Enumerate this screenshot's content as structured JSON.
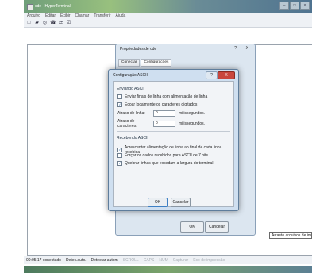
{
  "window": {
    "title": "cde - HyperTerminal",
    "controls": [
      "–",
      "□",
      "×"
    ]
  },
  "menu": [
    "Arquivo",
    "Editar",
    "Exibir",
    "Chamar",
    "Transferir",
    "Ajuda"
  ],
  "toolbar": {
    "icons": [
      "new-icon",
      "open-icon",
      "properties-icon",
      "disconnect-icon",
      "send-icon",
      "receive-icon"
    ],
    "glyphs": [
      "□",
      "▰",
      "◎",
      "☎",
      "⇄",
      "☑"
    ]
  },
  "properties_dialog": {
    "title": "Propriedades de cde",
    "help": "?",
    "close": "X",
    "tabs": [
      "Conectar",
      "Configurações"
    ],
    "ok": "OK",
    "cancel": "Cancelar"
  },
  "ascii_dialog": {
    "title": "Configuração ASCII",
    "help": "?",
    "close": "X",
    "sending_label": "Enviando ASCII",
    "send_line_ends": {
      "label": "Enviar finais de linha com alimentação de linha",
      "checked": false
    },
    "echo_local": {
      "label": "Ecoar localmente os caracteres digitados",
      "checked": true
    },
    "line_delay": {
      "label": "Atraso de linha:",
      "value": "0",
      "unit": "milissegundos."
    },
    "char_delay": {
      "label": "Atraso de caracteres:",
      "value": "0",
      "unit": "milissegundos."
    },
    "receiving_label": "Recebendo ASCII",
    "append_line_feeds": {
      "label": "Acrescentar alimentação de linha ao final de cada linha recebida",
      "checked": true
    },
    "force_7bit": {
      "label": "Forçar os dados recebidos para ASCII de 7 bits",
      "checked": false
    },
    "wrap_lines": {
      "label": "Quebrar linhas que excedam a largura do terminal",
      "checked": true
    },
    "check_glyph": "✓",
    "ok": "OK",
    "cancel": "Cancelar"
  },
  "drag_tip": "Arraste arquivos de im",
  "status": {
    "time": "00:05:17 conectado",
    "detect": "Detec.auto.",
    "detect2": "Detectar autom",
    "scroll": "SCROLL",
    "caps": "CAPS",
    "num": "NUM",
    "capture": "Capturar",
    "print": "Eco de impressão"
  }
}
